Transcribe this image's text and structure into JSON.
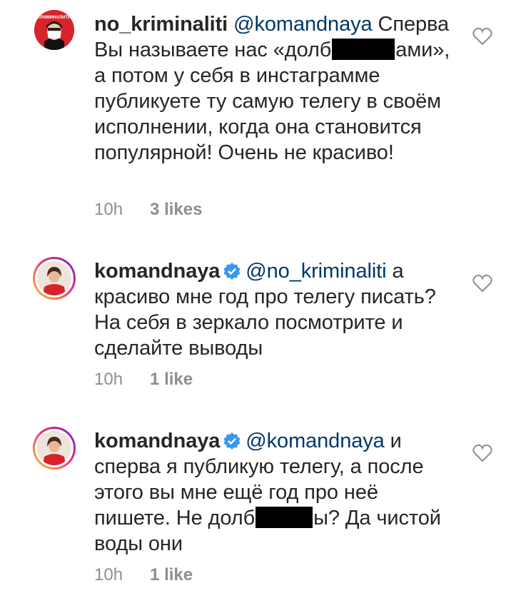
{
  "comments": [
    {
      "username": "no_kriminaliti",
      "avatar_icon": "masked-person-avatar",
      "mention": "@komandnaya",
      "text_parts": [
        "Сперва Вы называете нас «долб",
        "ами», а потом у себя в инстаграмме публикуете ту самую телегу в своём исполнении, когда она становится популярной! Очень не красиво!"
      ],
      "time": "10h",
      "likes": "3 likes",
      "verified": false
    },
    {
      "username": "komandnaya",
      "avatar_icon": "woman-in-red-avatar",
      "mention": "@no_kriminaliti",
      "text_parts": [
        "а красиво мне год про телегу писать? На себя в зеркало посмотрите и сделайте выводы"
      ],
      "time": "10h",
      "likes": "1 like",
      "verified": true
    },
    {
      "username": "komandnaya",
      "avatar_icon": "woman-in-red-avatar",
      "mention": "@komandnaya",
      "text_parts": [
        "и сперва я публикую телегу, а после этого вы мне ещё год про неё пишете. Не долб",
        "ы? Да чистой воды они"
      ],
      "time": "10h",
      "likes": "1 like",
      "verified": true
    }
  ],
  "colors": {
    "text": "#262626",
    "mention": "#00376b",
    "meta": "#8e8e8e",
    "verified": "#3897f0",
    "avatar_red": "#d8232a"
  }
}
